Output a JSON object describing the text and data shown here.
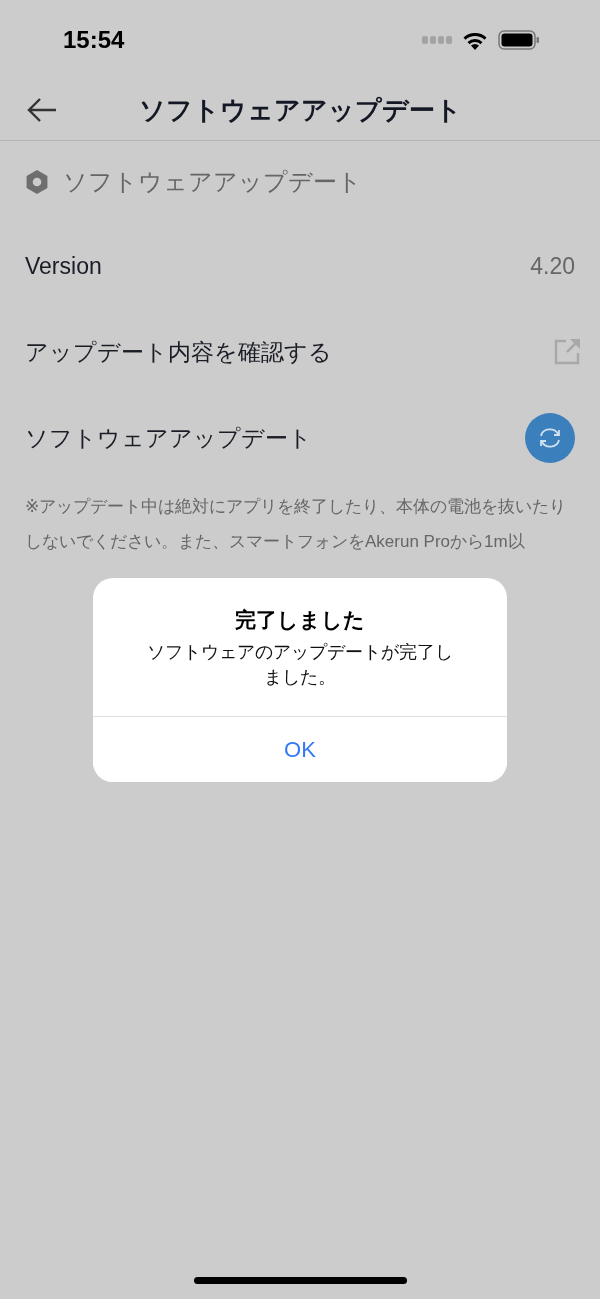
{
  "status_bar": {
    "time": "15:54"
  },
  "nav": {
    "title": "ソフトウェアアップデート"
  },
  "section": {
    "title": "ソフトウェアアップデート"
  },
  "rows": [
    {
      "kind": "value",
      "label": "Version",
      "value": "4.20"
    },
    {
      "kind": "link",
      "label": "アップデート内容を確認する"
    },
    {
      "kind": "action",
      "label": "ソフトウェアアップデート"
    }
  ],
  "note": "※アップデート中は絶対にアプリを終了したり、本体の電池を抜いたりしないでください。また、スマートフォンをAkerun Proから1m以",
  "dialog": {
    "title": "完了しました",
    "message": "ソフトウェアのアップデートが完了しました。",
    "buttons": [
      "OK"
    ]
  }
}
